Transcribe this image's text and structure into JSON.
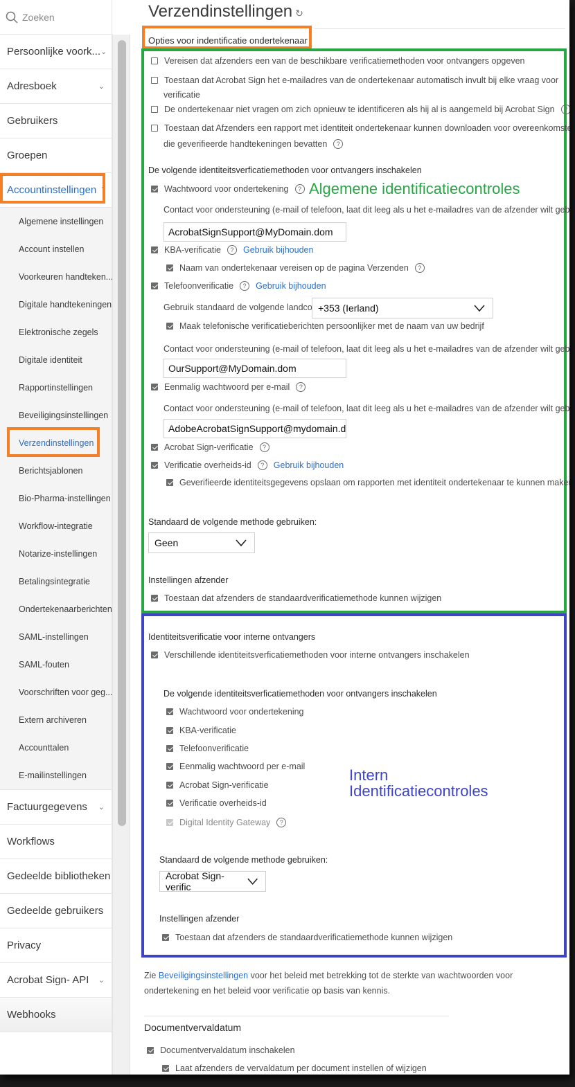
{
  "sidebar": {
    "search_placeholder": "Zoeken",
    "top_items": [
      {
        "label": "Persoonlijke voork...",
        "has_chevron": true
      },
      {
        "label": "Adresboek",
        "has_chevron": true
      },
      {
        "label": "Gebruikers"
      },
      {
        "label": "Groepen"
      },
      {
        "label": "Accountinstellingen",
        "expanded": true
      }
    ],
    "sub_items": [
      "Algemene instellingen",
      "Account instellen",
      "Voorkeuren handteken...",
      "Digitale handtekeningen",
      "Elektronische zegels",
      "Digitale identiteit",
      "Rapportinstellingen",
      "Beveiligingsinstellingen",
      "Verzendinstellingen",
      "Berichtsjablonen",
      "Bio-Pharma-instellingen",
      "Workflow-integratie",
      "Notarize-instellingen",
      "Betalingsintegratie",
      "Ondertekenaarberichten",
      "SAML-instellingen",
      "SAML-fouten",
      "Voorschriften voor geg...",
      "Extern archiveren",
      "Accounttalen",
      "E-mailinstellingen"
    ],
    "active_sub_item": "Verzendinstellingen",
    "bottom_items": [
      {
        "label": "Factuurgegevens",
        "has_chevron": true
      },
      {
        "label": "Workflows"
      },
      {
        "label": "Gedeelde bibliotheken"
      },
      {
        "label": "Gedeelde gebruikers"
      },
      {
        "label": "Privacy"
      },
      {
        "label": "Acrobat Sign- API",
        "has_chevron": true
      },
      {
        "label": "Webhooks"
      }
    ]
  },
  "main": {
    "title": "Verzendinstellingen",
    "refresh_icon": "↻",
    "section_title": "Opties voor indentificatie ondertekenaar",
    "general_options": [
      {
        "label": "Vereisen dat afzenders een van de beschikbare verificatiemethoden voor ontvangers opgeven",
        "checked": false
      },
      {
        "label": "Toestaan dat Acrobat Sign het e-mailadres van de ondertekenaar automatisch invult bij elke vraag voor",
        "label2": "verificatie",
        "checked": false
      },
      {
        "label": "De ondertekenaar niet vragen om zich opnieuw te identificeren als hij al is aangemeld bij Acrobat Sign",
        "checked": false,
        "help": true
      },
      {
        "label": "Toestaan dat Afzenders een rapport met identiteit ondertekenaar kunnen downloaden voor overeenkomsten",
        "label2": "die geverifieerde handtekeningen bevatten",
        "checked": false,
        "help": true
      }
    ],
    "methods_heading": "De volgende identiteitsverficatiemethoden voor ontvangers inschakelen",
    "annotation_general": "Algemene identificatiecontroles",
    "methods": {
      "password": {
        "label": "Wachtwoord voor ondertekening",
        "checked": true
      },
      "support_contact_label": "Contact voor ondersteuning (e-mail of telefoon, laat dit leeg als u het e-mailadres van de afzender wilt gebruiken):",
      "password_contact_value": "AcrobatSignSupport@MyDomain.dom",
      "kba": {
        "label": "KBA-verificatie",
        "checked": true,
        "link": "Gebruik bijhouden"
      },
      "kba_name": {
        "label": "Naam van ondertekenaar vereisen op de pagina Verzenden",
        "checked": true
      },
      "phone": {
        "label": "Telefoonverificatie",
        "checked": true,
        "link": "Gebruik bijhouden"
      },
      "country_code_label": "Gebruik standaard de volgende landcode:",
      "country_code_value": "+353 (Ierland)",
      "phone_personalize": {
        "label": "Maak telefonische verificatieberichten persoonlijker met de naam van uw bedrijf",
        "checked": true
      },
      "phone_contact_value": "OurSupport@MyDomain.dom",
      "email_otp": {
        "label": "Eenmalig wachtwoord per e-mail",
        "checked": true
      },
      "email_otp_contact_value": "AdobeAcrobatSignSupport@mydomain.dor",
      "acrobat_sign": {
        "label": "Acrobat Sign-verificatie",
        "checked": true
      },
      "gov_id": {
        "label": "Verificatie overheids-id",
        "checked": true,
        "link": "Gebruik bijhouden"
      },
      "gov_id_store": {
        "label": "Geverifieerde identiteitsgegevens opslaan om rapporten met identiteit ondertekenaar te kunnen maken",
        "checked": true
      }
    },
    "default_method_label": "Standaard de volgende methode gebruiken:",
    "default_method_value": "Geen",
    "sender_settings_heading": "Instellingen afzender",
    "sender_allow_change": {
      "label": "Toestaan dat afzenders de standaardverificatiemethode kunnen wijzigen",
      "checked": true
    },
    "internal": {
      "heading": "Identiteitsverificatie voor interne ontvangers",
      "enable": {
        "label": "Verschillende identiteitsverficatiemethoden voor interne ontvangers inschakelen",
        "checked": true
      },
      "methods_heading": "De volgende identiteitsverficatiemethoden voor ontvangers inschakelen",
      "methods": [
        {
          "label": "Wachtwoord voor ondertekening",
          "checked": true
        },
        {
          "label": "KBA-verificatie",
          "checked": true
        },
        {
          "label": "Telefoonverificatie",
          "checked": true
        },
        {
          "label": "Eenmalig wachtwoord per e-mail",
          "checked": true
        },
        {
          "label": "Acrobat Sign-verificatie",
          "checked": true
        },
        {
          "label": "Verificatie overheids-id",
          "checked": true
        },
        {
          "label": "Digital Identity Gateway",
          "checked": true,
          "disabled": true,
          "help": true
        }
      ],
      "annotation_line1": "Intern",
      "annotation_line2": "Identificatiecontroles",
      "default_method_label": "Standaard de volgende methode gebruiken:",
      "default_method_value": "Acrobat Sign-verific",
      "sender_settings_heading": "Instellingen afzender",
      "sender_allow_change": {
        "label": "Toestaan dat afzenders de standaardverificatiemethode kunnen wijzigen",
        "checked": true
      }
    },
    "footer_note": {
      "prefix": "Zie ",
      "link": "Beveiligingsinstellingen",
      "suffix": " voor het beleid met betrekking tot de sterkte van wachtwoorden voor ondertekening en het beleid voor verificatie op basis van kennis."
    },
    "doc_expiry": {
      "heading": "Documentvervaldatum",
      "enable": {
        "label": "Documentvervaldatum inschakelen",
        "checked": true
      },
      "allow_senders": {
        "label": "Laat afzenders de vervaldatum per document instellen of wijzigen",
        "checked": true
      }
    }
  },
  "colors": {
    "highlight_orange": "#f37f26",
    "highlight_green": "#2aa545",
    "highlight_blue": "#3e44c2",
    "link_blue": "#2d6fc4"
  }
}
